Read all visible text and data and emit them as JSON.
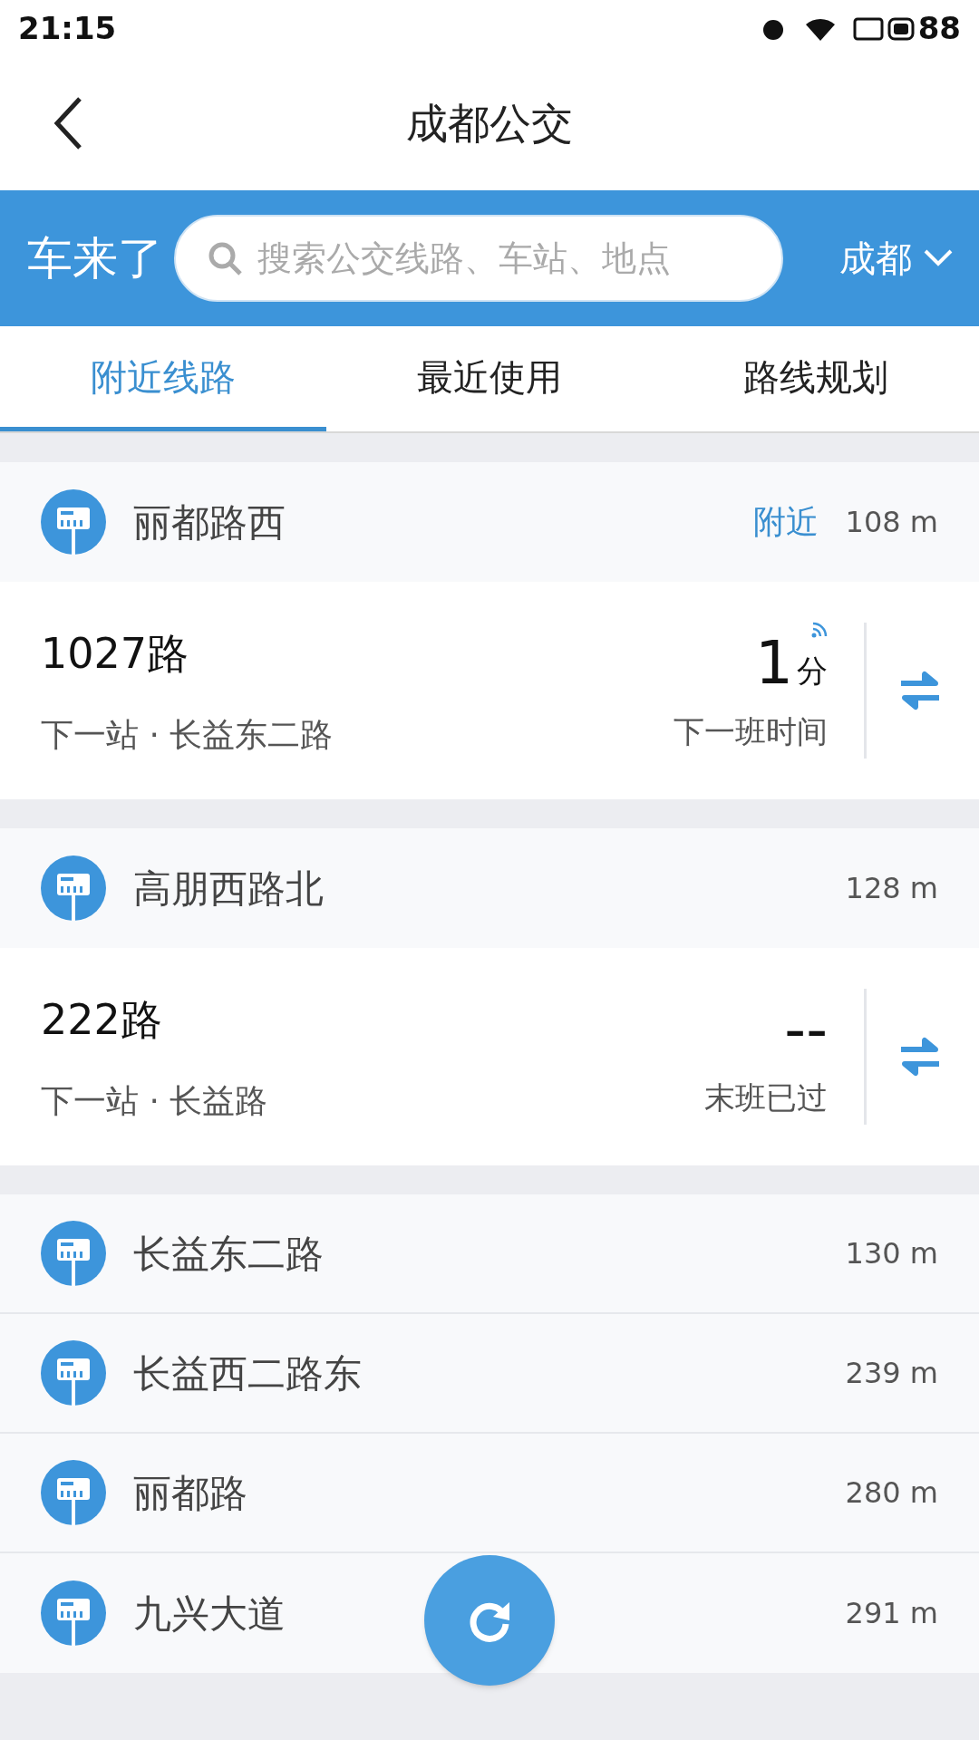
{
  "status_bar": {
    "time": "21:15",
    "battery": "88"
  },
  "header": {
    "title": "成都公交"
  },
  "search_bar": {
    "brand": "车来了",
    "placeholder": "搜索公交线路、车站、地点",
    "city": "成都"
  },
  "tabs": [
    {
      "label": "附近线路",
      "selected": true
    },
    {
      "label": "最近使用",
      "selected": false
    },
    {
      "label": "路线规划",
      "selected": false
    }
  ],
  "groups": [
    {
      "stops": [
        {
          "name": "丽都路西",
          "tag": "附近",
          "distance": "108 m",
          "lines": [
            {
              "name": "1027路",
              "next_stop": "下一站 · 长益东二路",
              "arrival": "1",
              "unit": "分",
              "realtime": true,
              "caption": "下一班时间"
            }
          ]
        }
      ]
    },
    {
      "stops": [
        {
          "name": "高朋西路北",
          "distance": "128 m",
          "lines": [
            {
              "name": "222路",
              "next_stop": "下一站 · 长益路",
              "arrival": "--",
              "realtime": false,
              "caption": "末班已过"
            }
          ]
        }
      ]
    },
    {
      "stops": [
        {
          "name": "长益东二路",
          "distance": "130 m"
        },
        {
          "name": "长益西二路东",
          "distance": "239 m"
        },
        {
          "name": "丽都路",
          "distance": "280 m"
        },
        {
          "name": "九兴大道",
          "distance": "291 m"
        }
      ]
    }
  ]
}
